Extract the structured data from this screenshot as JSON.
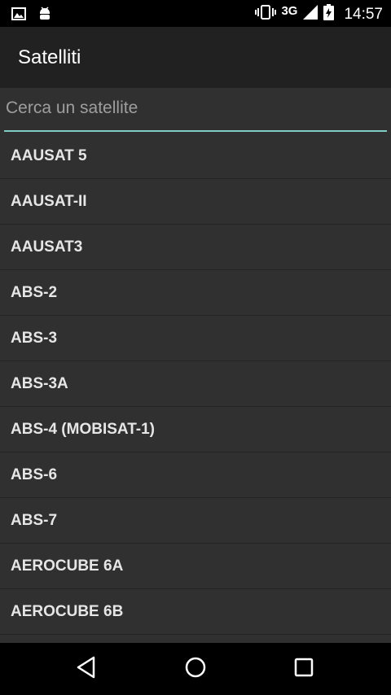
{
  "status_bar": {
    "network": "3G",
    "time": "14:57",
    "icons": [
      "gallery-icon",
      "android-debug-icon",
      "vibrate-icon",
      "signal-icon",
      "battery-charging-icon"
    ]
  },
  "app_bar": {
    "title": "Satelliti"
  },
  "search": {
    "placeholder": "Cerca un satellite",
    "value": ""
  },
  "satellites": [
    "AAUSAT 5",
    "AAUSAT-II",
    "AAUSAT3",
    "ABS-2",
    "ABS-3",
    "ABS-3A",
    "ABS-4 (MOBISAT-1)",
    "ABS-6",
    "ABS-7",
    "AEROCUBE 6A",
    "AEROCUBE 6B"
  ],
  "nav_bar": {
    "icons": [
      "back-icon",
      "home-icon",
      "recents-icon"
    ]
  },
  "colors": {
    "accent": "#80cbc4",
    "background": "#303030",
    "app_bar": "#212121"
  }
}
